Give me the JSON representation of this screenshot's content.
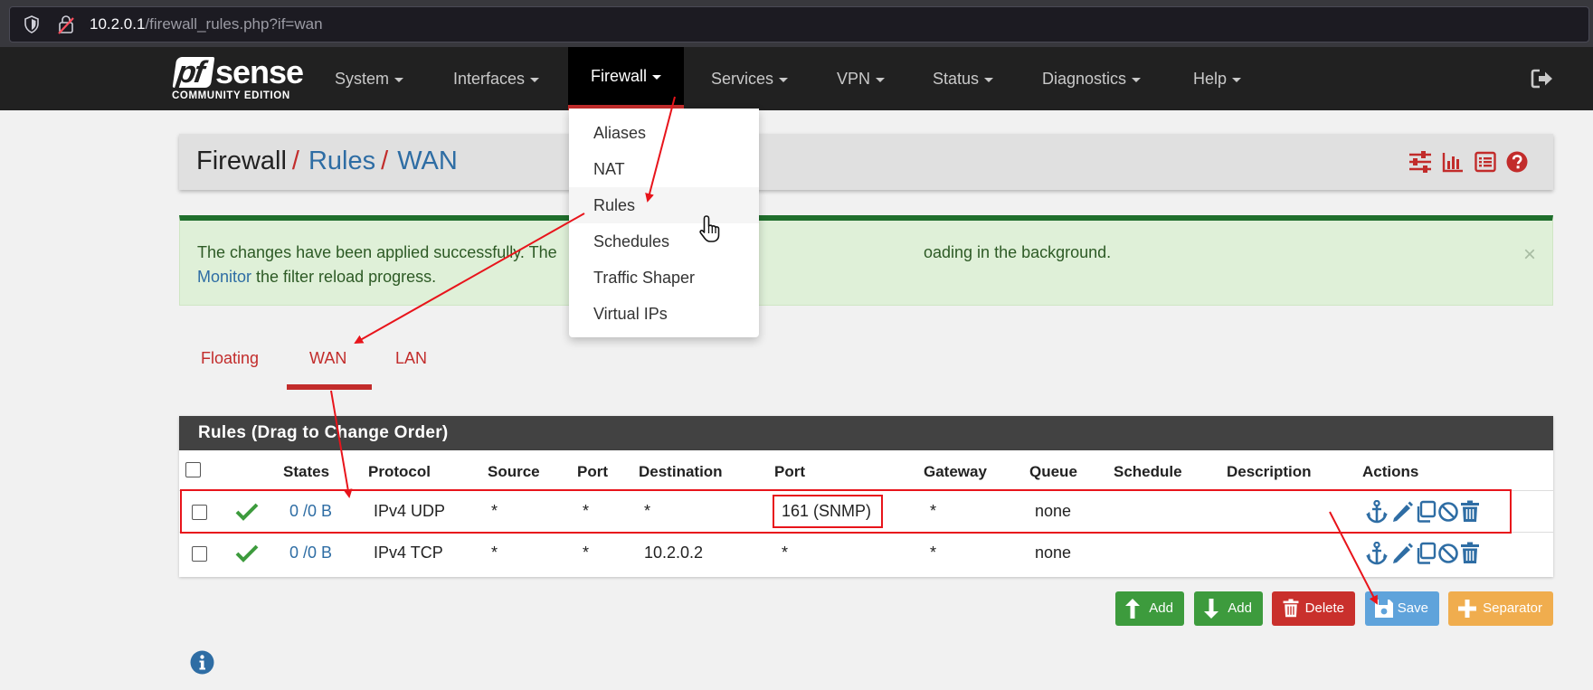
{
  "browser": {
    "url_host": "10.2.0.1",
    "url_path": "/firewall_rules.php?if=wan"
  },
  "brand": {
    "logo_pf": "pf",
    "logo_sense": "sense",
    "logo_edition": "COMMUNITY EDITION"
  },
  "nav": {
    "items": [
      "System",
      "Interfaces",
      "Firewall",
      "Services",
      "VPN",
      "Status",
      "Diagnostics",
      "Help"
    ],
    "active": "Firewall"
  },
  "firewall_menu": {
    "items": [
      "Aliases",
      "NAT",
      "Rules",
      "Schedules",
      "Traffic Shaper",
      "Virtual IPs"
    ],
    "hovered": "Rules"
  },
  "breadcrumb": {
    "items": [
      "Firewall",
      "Rules",
      "WAN"
    ],
    "separator": "/"
  },
  "alert": {
    "line1_start": "The changes have been applied successfully. The",
    "line1_end": "oading in the background.",
    "link": "Monitor",
    "line2_rest": " the filter reload progress.",
    "close": "×"
  },
  "tabs": {
    "items": [
      "Floating",
      "WAN",
      "LAN"
    ],
    "active": "WAN"
  },
  "rules": {
    "title": "Rules (Drag to Change Order)",
    "columns": [
      "States",
      "Protocol",
      "Source",
      "Port",
      "Destination",
      "Port",
      "Gateway",
      "Queue",
      "Schedule",
      "Description",
      "Actions"
    ],
    "rows": [
      {
        "states": "0 /0 B",
        "protocol": "IPv4 UDP",
        "source": "*",
        "source_port": "*",
        "destination": "*",
        "dest_port": "161 (SNMP)",
        "gateway": "*",
        "queue": "none",
        "schedule": "",
        "description": ""
      },
      {
        "states": "0 /0 B",
        "protocol": "IPv4 TCP",
        "source": "*",
        "source_port": "*",
        "destination": "10.2.0.2",
        "dest_port": "*",
        "gateway": "*",
        "queue": "none",
        "schedule": "",
        "description": ""
      }
    ]
  },
  "buttons": {
    "add_top": "Add",
    "add_bottom": "Add",
    "delete": "Delete",
    "save": "Save",
    "separator": "Separator"
  },
  "colors": {
    "brand_red": "#c22c2b",
    "link_blue": "#2e6da4",
    "success_green": "#3d9b3d",
    "annotation_red": "#e8141b"
  }
}
